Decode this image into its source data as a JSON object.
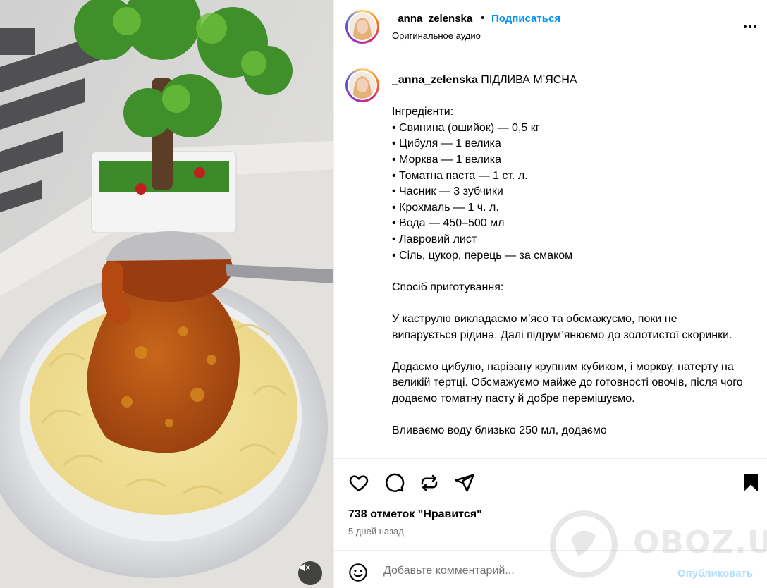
{
  "post": {
    "username": "_anna_zelenska",
    "dot": "•",
    "follow_label": "Подписаться",
    "audio_label": "Оригинальное аудио",
    "more_icon": "more-horizontal-icon"
  },
  "caption": {
    "username": "_anna_zelenska",
    "text": " ПІДЛИВА М’ЯСНА\n\nІнгредієнти:\n• Свинина (ошийок) — 0,5 кг\n• Цибуля — 1 велика\n• Морква — 1 велика\n• Томатна паста — 1 ст. л.\n• Часник — 3 зубчики\n• Крохмаль — 1 ч. л.\n• Вода — 450–500 мл\n• Лавровий лист\n• Сіль, цукор, перець — за смаком\n\nСпосіб приготування:\n\nУ каструлю викладаємо м’ясо та обсмажуємо, поки не випарується рідина. Далі підрум’янюємо до золотистої скоринки.\n\nДодаємо цибулю, нарізану крупним кубиком, і моркву, натерту на великій тертці. Обсмажуємо майже до готовності овочів, після чого додаємо томатну пасту й добре перемішуємо.\n\nВливаємо воду близько 250 мл, додаємо"
  },
  "actions": {
    "like_icon": "heart-icon",
    "comment_icon": "comment-icon",
    "repost_icon": "repost-icon",
    "share_icon": "share-icon",
    "save_icon": "bookmark-icon"
  },
  "likes_text": "738 отметок \"Нравится\"",
  "date_text": "5 дней назад",
  "comment": {
    "placeholder": "Добавьте комментарий...",
    "publish_label": "Опубликовать",
    "emoji_icon": "emoji-icon"
  },
  "media": {
    "mute_icon": "muted-speaker-icon"
  },
  "watermark": {
    "text": "OBOZ.UA"
  },
  "colors": {
    "link_blue": "#0095f6",
    "publish_disabled": "#b2dffc",
    "muted_text": "#737373",
    "divider": "#efefef"
  }
}
